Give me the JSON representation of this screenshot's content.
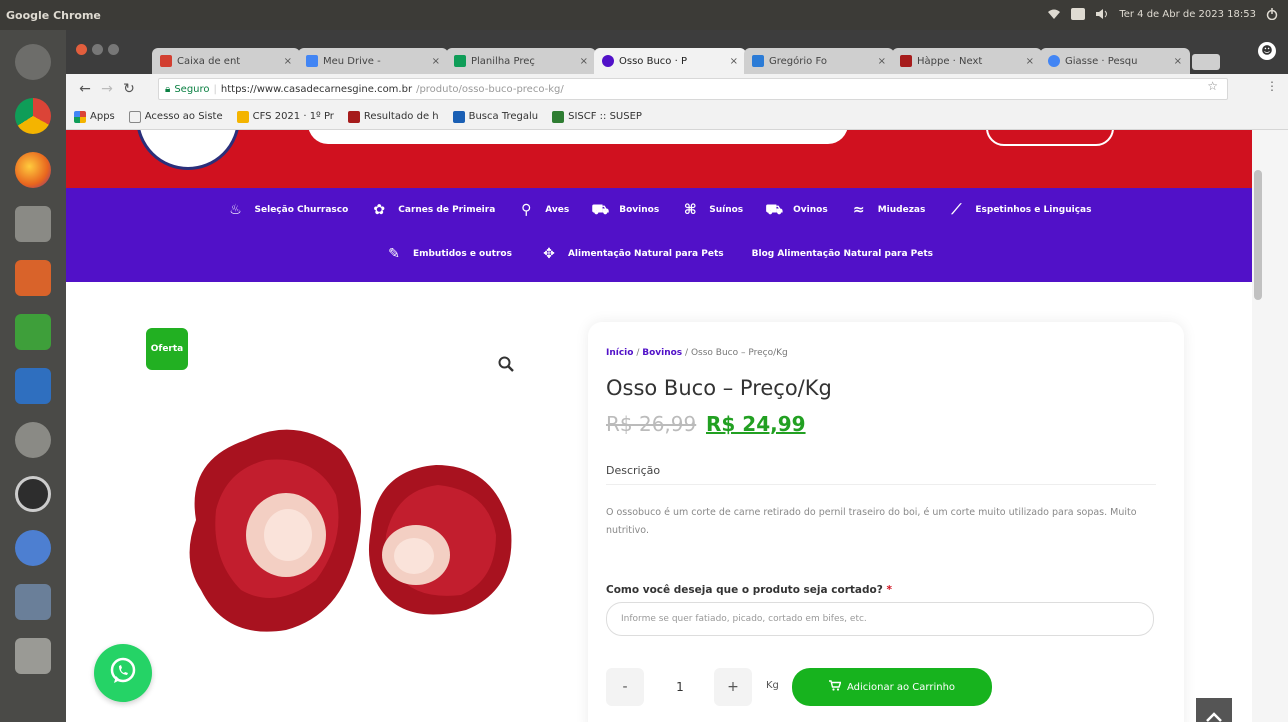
{
  "system": {
    "app_name": "Google Chrome",
    "clock": "Ter 4 de Abr de 2023 18:53"
  },
  "launcher": {
    "items": [
      {
        "name": "dash",
        "color": "#6d6d6a"
      },
      {
        "name": "chrome",
        "color": "#e9a23b"
      },
      {
        "name": "firefox",
        "color": "#e8651e"
      },
      {
        "name": "files",
        "color": "#8a8a85"
      },
      {
        "name": "impress",
        "color": "#d9632a"
      },
      {
        "name": "calc",
        "color": "#3e9f3a"
      },
      {
        "name": "writer",
        "color": "#2f6fbf"
      },
      {
        "name": "settings",
        "color": "#8a8a85"
      },
      {
        "name": "update",
        "color": "#3a3a3a"
      },
      {
        "name": "chromium",
        "color": "#4d7fd1"
      },
      {
        "name": "remmina",
        "color": "#6a7f99"
      },
      {
        "name": "trash",
        "color": "#9a9a95"
      }
    ]
  },
  "tabs": [
    {
      "label": "Caixa de ent",
      "color": "#d23f31",
      "active": false
    },
    {
      "label": "Meu Drive -",
      "color": "#4285f4",
      "active": false
    },
    {
      "label": "Planilha Preç",
      "color": "#0f9d58",
      "active": false
    },
    {
      "label": "Osso Buco · P",
      "color": "#5111c8",
      "active": true
    },
    {
      "label": "Gregório Fo",
      "color": "#2b7bd6",
      "active": false
    },
    {
      "label": "Hàppe · Next",
      "color": "#a61c1c",
      "active": false
    },
    {
      "label": "Giasse · Pesqu",
      "color": "#4285f4",
      "active": false
    }
  ],
  "toolbar": {
    "secure_label": "Seguro",
    "url": "https://www.casadecarnesgine.com.br",
    "url_path": "/produto/osso-buco-preco-kg/"
  },
  "bookmarks": [
    {
      "label": "Apps",
      "color": "#4285f4"
    },
    {
      "label": "Acesso ao Siste",
      "color": "#888888"
    },
    {
      "label": "CFS 2021 · 1º Pr",
      "color": "#1a73e8"
    },
    {
      "label": "Resultado de h",
      "color": "#a61c1c"
    },
    {
      "label": "Busca Tregalu",
      "color": "#1a5fb4"
    },
    {
      "label": "SISCF :: SUSEP",
      "color": "#2e7d32"
    }
  ],
  "nav": {
    "row1": [
      {
        "label": "Seleção Churrasco",
        "icon": "grill-icon",
        "glyph": "♨"
      },
      {
        "label": "Carnes de Primeira",
        "icon": "award-icon",
        "glyph": "✿"
      },
      {
        "label": "Aves",
        "icon": "drumstick-icon",
        "glyph": "⚲"
      },
      {
        "label": "Bovinos",
        "icon": "cart-icon",
        "glyph": "⛟"
      },
      {
        "label": "Suínos",
        "icon": "pig-icon",
        "glyph": "⌘"
      },
      {
        "label": "Ovinos",
        "icon": "cart-icon",
        "glyph": "⛟"
      },
      {
        "label": "Miudezas",
        "icon": "fish-icon",
        "glyph": "≈"
      },
      {
        "label": "Espetinhos e Linguiças",
        "icon": "skewer-icon",
        "glyph": "⟋"
      }
    ],
    "row2": [
      {
        "label": "Embutidos e outros",
        "icon": "sausage-icon",
        "glyph": "✎"
      },
      {
        "label": "Alimentação Natural para Pets",
        "icon": "paw-icon",
        "glyph": "✥"
      },
      {
        "label": "Blog Alimentação Natural para Pets",
        "icon": "",
        "glyph": ""
      }
    ]
  },
  "product": {
    "badge": "Oferta",
    "breadcrumb_home": "Início",
    "breadcrumb_category": "Bovinos",
    "breadcrumb_current": "Osso Buco – Preço/Kg",
    "breadcrumb_sep": " / ",
    "title": "Osso Buco – Preço/Kg",
    "old_price": "R$ 26,99",
    "new_price": "R$ 24,99",
    "description_heading": "Descrição",
    "description": "O ossobuco é um corte de carne retirado do pernil traseiro do boi, é um corte muito utilizado para sopas. Muito nutritivo.",
    "cut_label": "Como você deseja que o produto seja cortado?",
    "cut_required": "*",
    "cut_placeholder": "Informe se quer fatiado, picado, cortado em bifes, etc.",
    "qty_minus": "-",
    "qty_value": "1",
    "qty_plus": "+",
    "unit": "Kg",
    "add_to_cart": "Adicionar ao Carrinho"
  },
  "colors": {
    "header_red": "#d0111f",
    "nav_purple": "#5111c8",
    "price_green": "#22a022",
    "cart_green": "#17b31e",
    "whatsapp_green": "#25d366"
  }
}
